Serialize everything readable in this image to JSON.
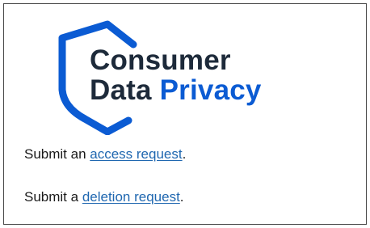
{
  "logo": {
    "line1": "Consumer",
    "line2_part1": "Data",
    "line2_part2": "Privacy",
    "icon": "shield-icon",
    "colors": {
      "shield": "#0b5bd3",
      "dark_text": "#1d2a3a",
      "accent_text": "#0b5bd3"
    }
  },
  "access": {
    "prefix": "Submit an ",
    "link_text": "access request",
    "suffix": "."
  },
  "deletion": {
    "prefix": "Submit a ",
    "link_text": "deletion request",
    "suffix": "."
  },
  "colors": {
    "link": "#1f67b0",
    "text": "#1a1a1a",
    "border": "#4a4a4a"
  }
}
